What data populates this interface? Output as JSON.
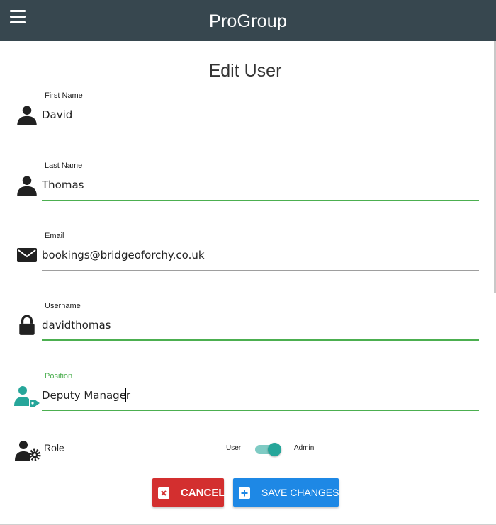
{
  "header": {
    "app_title": "ProGroup",
    "bg_color": "#37474f",
    "menu_icon": "hamburger-menu-icon"
  },
  "page": {
    "title": "Edit User"
  },
  "form": {
    "first_name": {
      "label": "First Name",
      "value": "David",
      "icon": "person-icon"
    },
    "last_name": {
      "label": "Last Name",
      "value": "Thomas",
      "icon": "person-icon"
    },
    "email": {
      "label": "Email",
      "value": "bookings@bridgeoforchy.co.uk",
      "icon": "envelope-icon"
    },
    "username": {
      "label": "Username",
      "value": "davidthomas",
      "icon": "lock-icon"
    },
    "position": {
      "label": "Position",
      "value": "Deputy Manager",
      "icon": "user-tag-icon",
      "focused": true
    },
    "role": {
      "label": "Role",
      "icon": "user-gear-icon",
      "off_label": "User",
      "on_label": "Admin",
      "is_admin": true
    }
  },
  "actions": {
    "cancel_label": "CANCEL",
    "save_label": "SAVE CHANGES"
  },
  "colors": {
    "accent_green": "#4caf50",
    "teal": "#26a69a",
    "cancel_red": "#d32f2f",
    "save_blue": "#1e88e5"
  }
}
